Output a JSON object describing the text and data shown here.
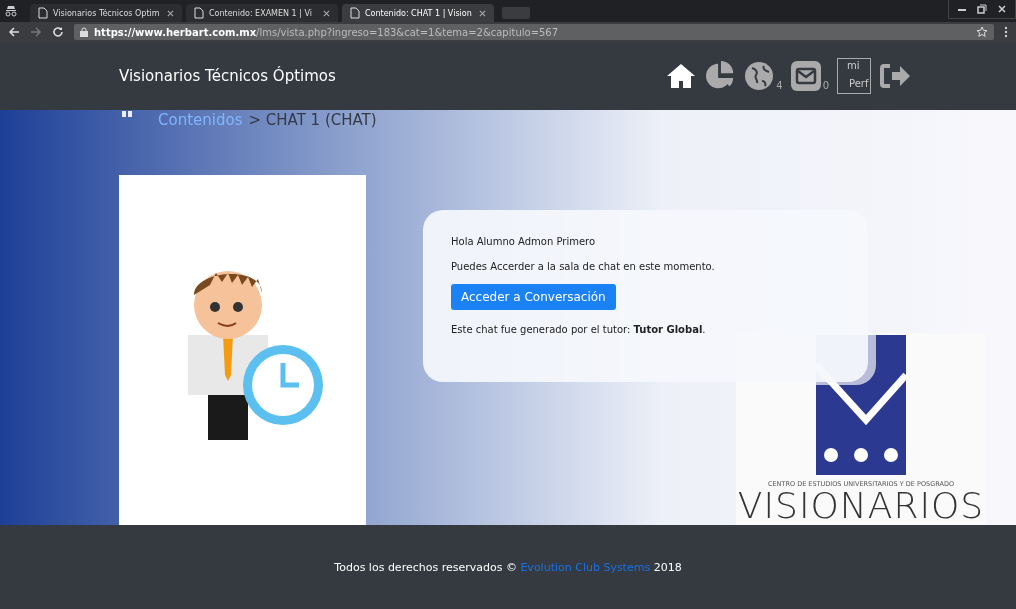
{
  "browser": {
    "tabs": [
      {
        "title": "Visionarios Técnicos Óptim",
        "selected": false
      },
      {
        "title": "Contenido: EXAMEN 1 | Vi",
        "selected": false
      },
      {
        "title": "Contenido: CHAT 1 | Vision",
        "selected": true
      }
    ],
    "url": {
      "host": "https://www.herbart.com.mx",
      "path": "/lms/vista.php?ingreso=183&cat=1&tema=2&capitulo=567"
    }
  },
  "navbar": {
    "brand": "Visionarios Técnicos Óptimos",
    "items": [
      {
        "kind": "home"
      },
      {
        "kind": "chart"
      },
      {
        "kind": "globe",
        "badge": "4"
      },
      {
        "kind": "mail",
        "badge": "0"
      },
      {
        "kind": "avatar",
        "alt_lines": [
          "mi",
          "Perf"
        ]
      },
      {
        "kind": "logout"
      }
    ]
  },
  "breadcrumb": {
    "link": "Contenidos",
    "current": "> CHAT 1 (CHAT)"
  },
  "card": {
    "greeting": "Hola Alumno Admon Primero",
    "message": "Puedes Accerder a la sala de chat en este momento.",
    "button": "Acceder a Conversación",
    "note": "Este chat fue generado por el tutor: **Tutor Global**."
  },
  "logo": {
    "tagline": "CENTRO DE ESTUDIOS UNIVERSITARIOS Y DE POSGRADO",
    "name": "VISIONARIOS"
  },
  "footer": {
    "prefix": "Todos los derechos reservados ©",
    "link": "Evolution Club Systems",
    "suffix": "2018"
  }
}
